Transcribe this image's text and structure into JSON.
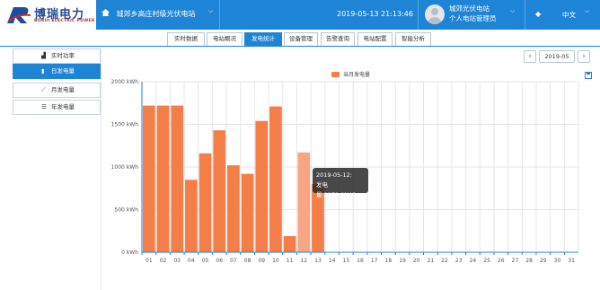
{
  "header": {
    "logo_name": "博瑞电力",
    "logo_sub": "BORUI ELECTRIC POWER",
    "station_name": "城郊乡高庄村级光伏电站",
    "datetime": "2019-05-13 21:13:46",
    "user_station": "城郊光伏电站",
    "user_role": "个人电站管理员",
    "language": "中文"
  },
  "tabs": [
    "实时数据",
    "电站概况",
    "发电统计",
    "设备管理",
    "告警查询",
    "电站配置",
    "智能分析"
  ],
  "active_tab": "发电统计",
  "sidebar": [
    {
      "label": "实时功率",
      "icon": "area-chart-icon"
    },
    {
      "label": "日发电量",
      "icon": "bar-chart-icon"
    },
    {
      "label": "月发电量",
      "icon": "line-chart-icon"
    },
    {
      "label": "年发电量",
      "icon": "database-icon"
    }
  ],
  "date_picker": {
    "value": "2019-05",
    "prev": "‹",
    "next": "›"
  },
  "tooltip": {
    "title": "2019-05-12:",
    "text": "发电量:1171.0kWh"
  },
  "chart_data": {
    "type": "bar",
    "title": "",
    "legend": [
      "当月发电量"
    ],
    "legend_position": "top-center",
    "xlabel": "",
    "ylabel": "",
    "y_unit": "kWh",
    "ylim": [
      0,
      2000
    ],
    "yticks": [
      0,
      500,
      1000,
      1500,
      2000
    ],
    "ytick_labels": [
      "0 kWh",
      "500 kWh",
      "1000 kWh",
      "1500 kWh",
      "2000 kWh"
    ],
    "grid": true,
    "bar_color": "#f47e48",
    "highlight_color": "#f8a583",
    "highlight_index": 11,
    "categories": [
      "01",
      "02",
      "03",
      "04",
      "05",
      "06",
      "07",
      "08",
      "09",
      "10",
      "11",
      "12",
      "13",
      "14",
      "15",
      "16",
      "17",
      "18",
      "19",
      "20",
      "21",
      "22",
      "23",
      "24",
      "25",
      "26",
      "27",
      "28",
      "29",
      "30",
      "31"
    ],
    "series": [
      {
        "name": "当月发电量",
        "values": [
          1720,
          1720,
          1720,
          850,
          1160,
          1430,
          1020,
          920,
          1540,
          1710,
          190,
          1171,
          800,
          null,
          null,
          null,
          null,
          null,
          null,
          null,
          null,
          null,
          null,
          null,
          null,
          null,
          null,
          null,
          null,
          null,
          null
        ]
      }
    ]
  }
}
